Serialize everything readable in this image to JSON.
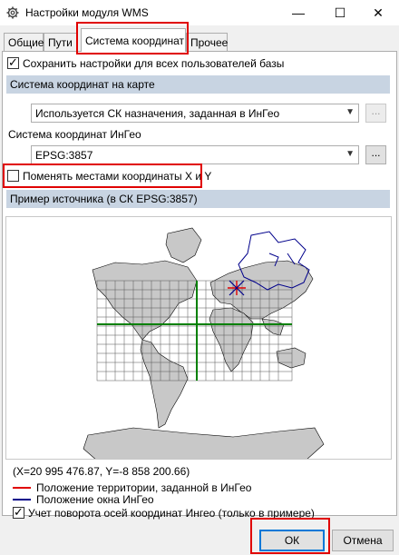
{
  "window": {
    "title": "Настройки модуля WMS",
    "minimize": "—",
    "maximize": "☐",
    "close": "✕"
  },
  "tabs": [
    {
      "label": "Общие",
      "active": false
    },
    {
      "label": "Пути",
      "active": false
    },
    {
      "label": "Система координат",
      "active": true
    },
    {
      "label": "Прочее",
      "active": false
    }
  ],
  "save_for_all": {
    "label": "Сохранить настройки для всех пользователей базы",
    "checked": true
  },
  "map_cs_section": "Система координат на карте",
  "map_cs_combo": {
    "value": "Используется СК назначения, заданная в ИнГео"
  },
  "ingeo_cs_label": "Система координат ИнГео",
  "ingeo_cs_combo": {
    "value": "EPSG:3857"
  },
  "browse_button": "...",
  "swap_xy": {
    "label": "Поменять местами координаты X и Y",
    "checked": false
  },
  "sample_section": "Пример источника (в СК EPSG:3857)",
  "coords_text": "(X=20 995 476.87, Y=-8 858 200.66)",
  "legend": [
    {
      "label": "Положение территории, заданной в ИнГео",
      "color": "#e00000"
    },
    {
      "label": "Положение окна ИнГео",
      "color": "#00008b"
    }
  ],
  "rotation": {
    "label": "Учет поворота осей координат Ингео (только в примере)",
    "checked": true
  },
  "ok_button": "ОК",
  "cancel_button": "Отмена",
  "colors": {
    "highlight": "#e00000",
    "section_bg": "#c8d4e2",
    "grid_axis": "#008000"
  }
}
